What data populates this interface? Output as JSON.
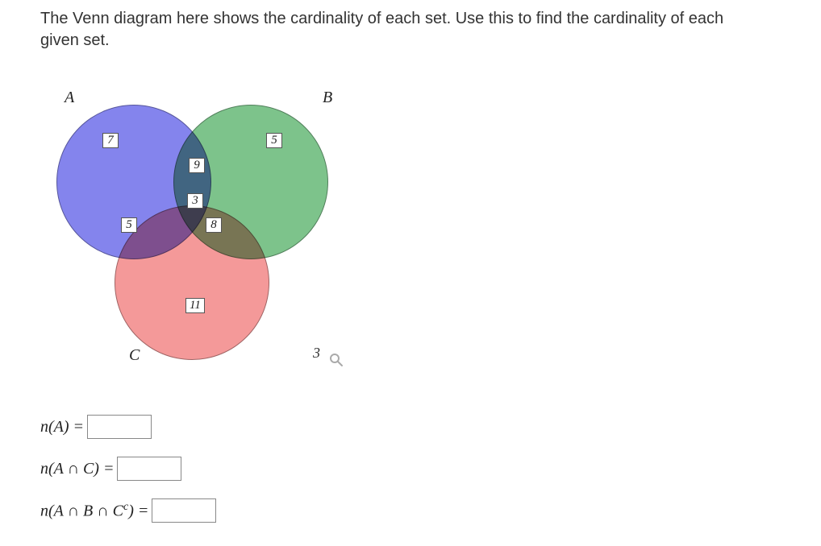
{
  "prompt_text": "The Venn diagram here shows the cardinality of each set. Use this to find the cardinality of each given set.",
  "venn": {
    "labels": {
      "A": "A",
      "B": "B",
      "C": "C"
    },
    "regions": {
      "A_only": "7",
      "B_only": "5",
      "C_only": "11",
      "A_and_B_only": "9",
      "A_and_C_only": "5",
      "B_and_C_only": "8",
      "A_and_B_and_C": "3",
      "outside": "3"
    }
  },
  "questions": {
    "q1": {
      "label_html": "n(A) =",
      "value": ""
    },
    "q2": {
      "label_html": "n(A ∩ C) =",
      "value": ""
    },
    "q3": {
      "label_prefix": "n(A ∩ B ∩ C",
      "label_sup": "c",
      "label_suffix": ") =",
      "value": ""
    }
  },
  "chart_data": {
    "type": "venn3",
    "sets": [
      "A",
      "B",
      "C"
    ],
    "region_cardinalities": {
      "A_only": 7,
      "B_only": 5,
      "C_only": 11,
      "A∩B_only": 9,
      "A∩C_only": 5,
      "B∩C_only": 8,
      "A∩B∩C": 3,
      "outside_all": 3
    },
    "title": "Three-set Venn diagram with region cardinalities",
    "colors": {
      "A": "#5050e6",
      "B": "#46aa5a",
      "C": "#f06e6e"
    }
  }
}
